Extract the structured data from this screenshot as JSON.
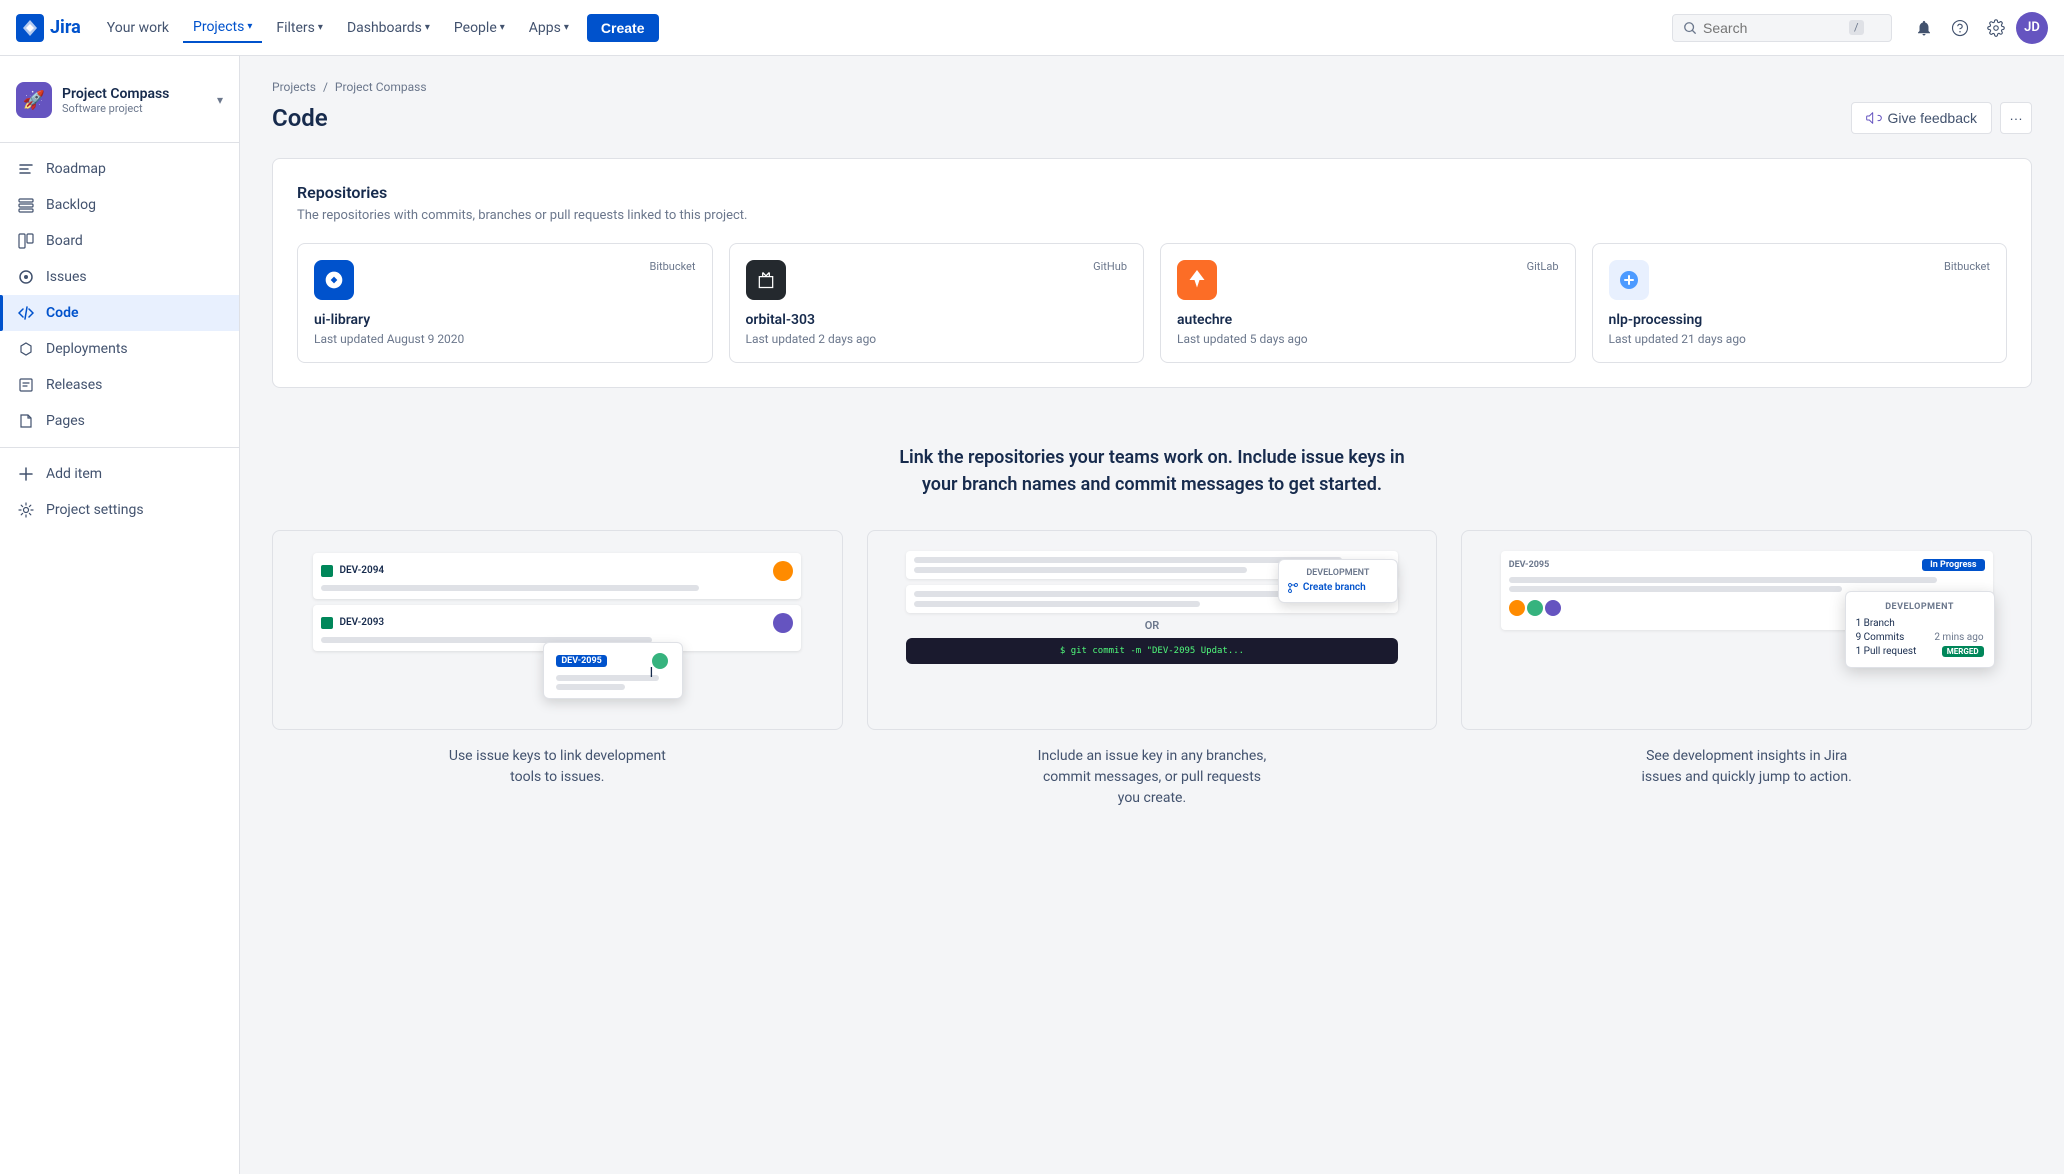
{
  "topnav": {
    "logo_text": "Jira",
    "links": [
      {
        "label": "Your work",
        "active": false
      },
      {
        "label": "Projects",
        "active": true,
        "has_chevron": true
      },
      {
        "label": "Filters",
        "active": false,
        "has_chevron": true
      },
      {
        "label": "Dashboards",
        "active": false,
        "has_chevron": true
      },
      {
        "label": "People",
        "active": false,
        "has_chevron": true
      },
      {
        "label": "Apps",
        "active": false,
        "has_chevron": true
      }
    ],
    "create_label": "Create",
    "search_placeholder": "Search",
    "search_shortcut": "/"
  },
  "sidebar": {
    "project_name": "Project Compass",
    "project_type": "Software project",
    "items": [
      {
        "label": "Roadmap",
        "icon": "🗺",
        "active": false
      },
      {
        "label": "Backlog",
        "icon": "☰",
        "active": false
      },
      {
        "label": "Board",
        "icon": "⊞",
        "active": false
      },
      {
        "label": "Issues",
        "icon": "⬡",
        "active": false
      },
      {
        "label": "Code",
        "icon": "⟨/⟩",
        "active": true
      },
      {
        "label": "Deployments",
        "icon": "🚀",
        "active": false
      },
      {
        "label": "Releases",
        "icon": "📋",
        "active": false
      },
      {
        "label": "Pages",
        "icon": "📄",
        "active": false
      },
      {
        "label": "Add item",
        "icon": "+",
        "active": false
      },
      {
        "label": "Project settings",
        "icon": "⚙",
        "active": false
      }
    ]
  },
  "breadcrumb": {
    "parts": [
      "Projects",
      "Project Compass"
    ],
    "separator": "/"
  },
  "page": {
    "title": "Code",
    "feedback_label": "Give feedback",
    "more_label": "···"
  },
  "repositories": {
    "section_title": "Repositories",
    "section_subtitle": "The repositories with commits, branches or pull requests linked to this project.",
    "items": [
      {
        "name": "ui-library",
        "source": "Bitbucket",
        "source_type": "bitbucket",
        "last_updated": "Last updated August 9 2020",
        "icon": "↻"
      },
      {
        "name": "orbital-303",
        "source": "GitHub",
        "source_type": "github",
        "last_updated": "Last updated 2 days ago",
        "icon": "<>"
      },
      {
        "name": "autechre",
        "source": "GitLab",
        "source_type": "gitlab",
        "last_updated": "Last updated 5 days ago",
        "icon": "<>"
      },
      {
        "name": "nlp-processing",
        "source": "Bitbucket",
        "source_type": "bitbucket2",
        "last_updated": "Last updated 21 days ago",
        "icon": "🤖"
      }
    ]
  },
  "info_section": {
    "title": "Link the repositories your teams work on. Include issue keys in\nyour branch names and commit messages to get started.",
    "items": [
      {
        "text": "Use issue keys to link development\ntools to issues.",
        "visual_type": "issues"
      },
      {
        "text": "Include an issue key in any branches,\ncommit messages, or pull requests\nyou create.",
        "visual_type": "commit"
      },
      {
        "text": "See development insights in Jira\nissues and quickly jump to action.",
        "visual_type": "insights"
      }
    ]
  }
}
